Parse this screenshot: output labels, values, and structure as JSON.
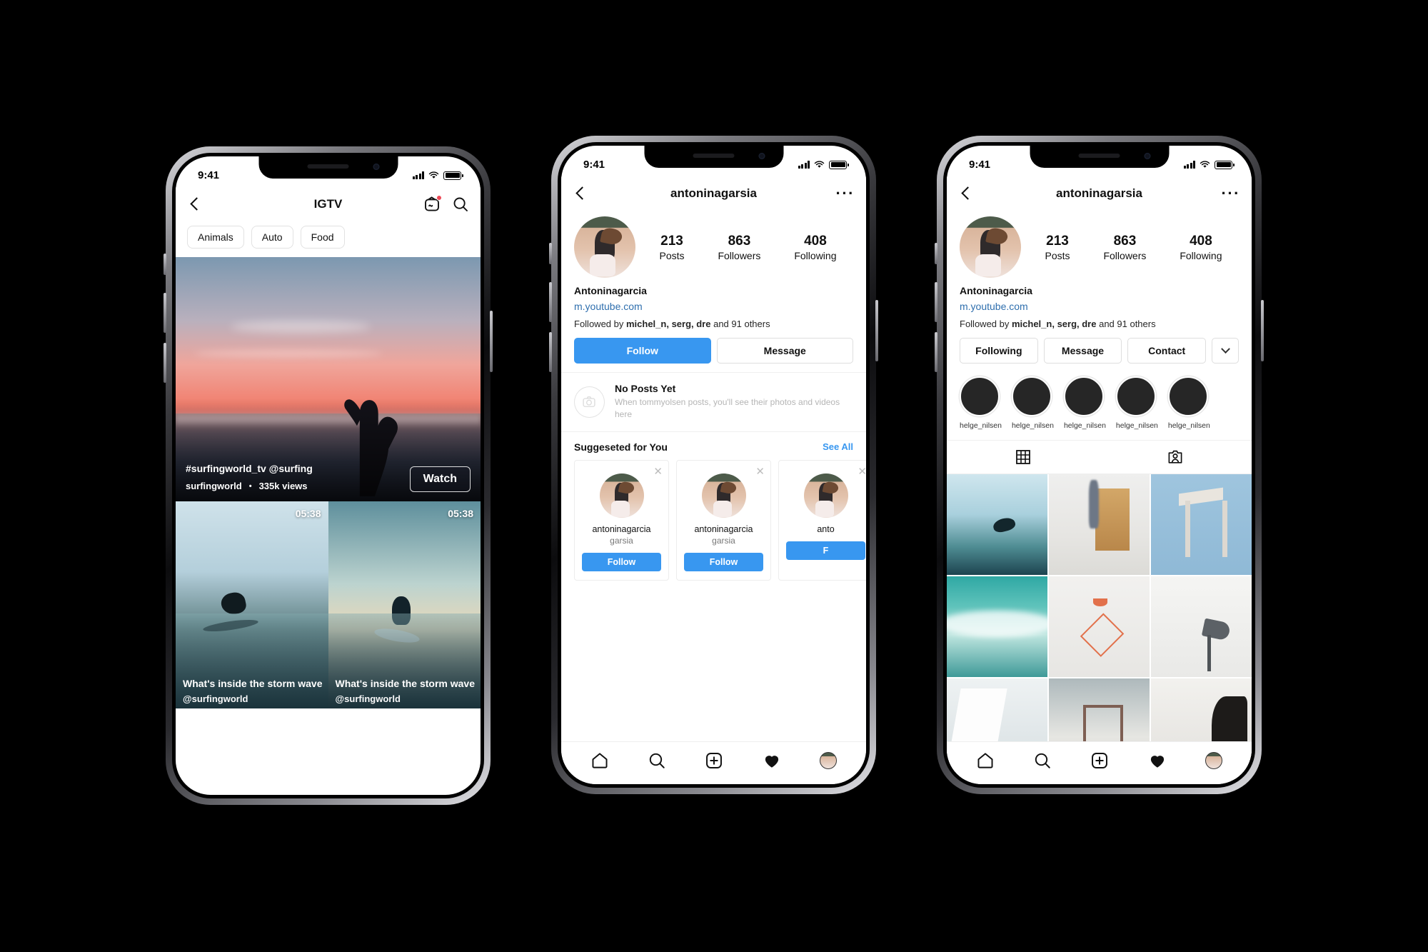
{
  "status_bar": {
    "time": "9:41",
    "signal_icon": "cellular-signal-icon",
    "wifi_icon": "wifi-icon",
    "battery_icon": "battery-icon"
  },
  "phone1": {
    "nav": {
      "back_icon": "chevron-left-icon",
      "title": "IGTV",
      "igtv_icon": "igtv-icon",
      "search_icon": "search-icon"
    },
    "pills": [
      "Animals",
      "Auto",
      "Food"
    ],
    "hero": {
      "hashtag": "#surfingworld_tv @surfing",
      "channel": "surfingworld",
      "separator": "•",
      "views": "335k views",
      "watch_label": "Watch"
    },
    "thumbs": [
      {
        "duration": "05:38",
        "title": "What's inside the storm wave",
        "user": "@surfingworld"
      },
      {
        "duration": "05:38",
        "title": "What's inside the storm wave",
        "user": "@surfingworld"
      }
    ]
  },
  "phone2": {
    "nav": {
      "back_icon": "chevron-left-icon",
      "title": "antoninagarsia",
      "more_icon": "more-options-icon"
    },
    "stats": [
      {
        "num": "213",
        "label": "Posts"
      },
      {
        "num": "863",
        "label": "Followers"
      },
      {
        "num": "408",
        "label": "Following"
      }
    ],
    "bio": {
      "name": "Antoninagarcia",
      "link": "m.youtube.com",
      "followed_prefix": "Followed by ",
      "followed_names": "michel_n, serg, dre",
      "followed_suffix": " and 91 others"
    },
    "actions": {
      "follow": "Follow",
      "message": "Message"
    },
    "no_posts": {
      "icon": "camera-icon",
      "title": "No Posts Yet",
      "subtitle": "When tommyolsen posts, you'll see their photos and videos here"
    },
    "suggested": {
      "heading": "Suggeseted for You",
      "see_all": "See All",
      "cards": [
        {
          "username": "antoninagarcia",
          "name": "garsia",
          "follow": "Follow",
          "close_icon": "close-icon"
        },
        {
          "username": "antoninagarcia",
          "name": "garsia",
          "follow": "Follow",
          "close_icon": "close-icon"
        },
        {
          "username": "anto",
          "name": "",
          "follow": "F",
          "close_icon": "close-icon"
        }
      ]
    }
  },
  "phone3": {
    "nav": {
      "back_icon": "chevron-left-icon",
      "title": "antoninagarsia",
      "more_icon": "more-options-icon"
    },
    "stats": [
      {
        "num": "213",
        "label": "Posts"
      },
      {
        "num": "863",
        "label": "Followers"
      },
      {
        "num": "408",
        "label": "Following"
      }
    ],
    "bio": {
      "name": "Antoninagarcia",
      "link": "m.youtube.com",
      "followed_prefix": "Followed by ",
      "followed_names": "michel_n, serg, dre",
      "followed_suffix": " and 91 others"
    },
    "actions": {
      "following": "Following",
      "message": "Message",
      "contact": "Contact",
      "more_icon": "chevron-down-icon"
    },
    "highlights": [
      {
        "label": "helge_nilsen"
      },
      {
        "label": "helge_nilsen"
      },
      {
        "label": "helge_nilsen"
      },
      {
        "label": "helge_nilsen"
      },
      {
        "label": "helge_nilsen"
      }
    ],
    "tabs": [
      {
        "icon": "grid-view-icon",
        "active": true
      },
      {
        "icon": "tagged-photos-icon",
        "active": false
      }
    ],
    "grid": [
      "surfer-riding-wave",
      "person-walking-past-cabinet",
      "wooden-stool-blue-bg",
      "breaking-turquoise-wave",
      "copper-pendant-lamp",
      "grey-desk-lamp",
      "white-chair-corner",
      "metal-stool-partial",
      "dark-plant-partial"
    ]
  },
  "tabbar": {
    "home_icon": "home-icon",
    "search_icon": "search-icon",
    "add_icon": "add-post-icon",
    "activity_icon": "heart-icon",
    "profile_icon": "profile-avatar-icon"
  },
  "colors": {
    "accent_blue": "#3897f0",
    "link_blue": "#2f6fae",
    "text_primary": "#111111",
    "background": "#000000"
  }
}
